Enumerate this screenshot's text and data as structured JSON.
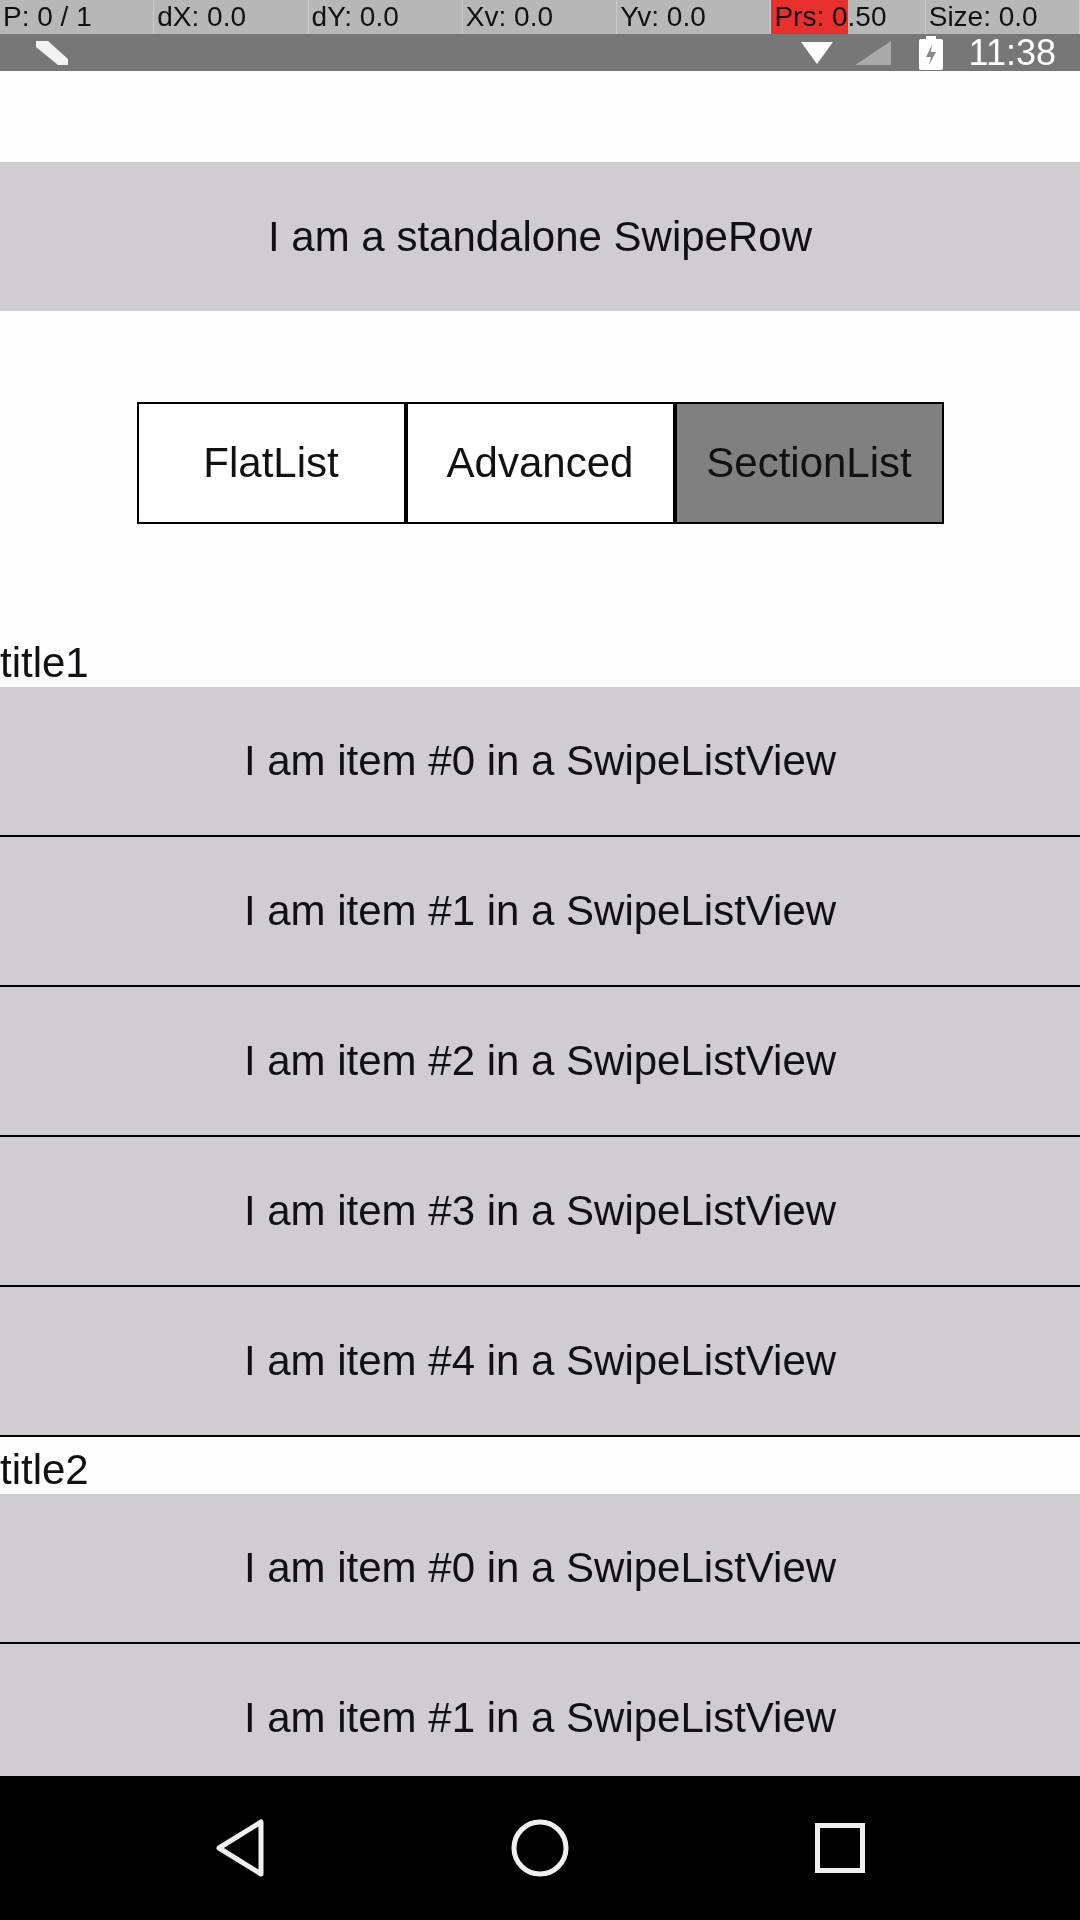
{
  "status_bar": {
    "pointer_info": [
      {
        "text": "P: 0 / 1"
      },
      {
        "text": "dX: 0.0"
      },
      {
        "text": "dY: 0.0"
      },
      {
        "text": "Xv: 0.0"
      },
      {
        "text": "Yv: 0.0"
      },
      {
        "text": "Prs: 0.50",
        "level": 0.5
      },
      {
        "text": "Size: 0.0"
      }
    ],
    "time": "11:38"
  },
  "standalone_row": {
    "label": "I am a standalone SwipeRow"
  },
  "tabs": [
    {
      "label": "FlatList",
      "selected": false
    },
    {
      "label": "Advanced",
      "selected": false
    },
    {
      "label": "SectionList",
      "selected": true
    }
  ],
  "sections": [
    {
      "title": "title1",
      "rows": [
        "I am item #0 in a SwipeListView",
        "I am item #1 in a SwipeListView",
        "I am item #2 in a SwipeListView",
        "I am item #3 in a SwipeListView",
        "I am item #4 in a SwipeListView"
      ]
    },
    {
      "title": "title2",
      "rows": [
        "I am item #0 in a SwipeListView",
        "I am item #1 in a SwipeListView"
      ]
    }
  ]
}
